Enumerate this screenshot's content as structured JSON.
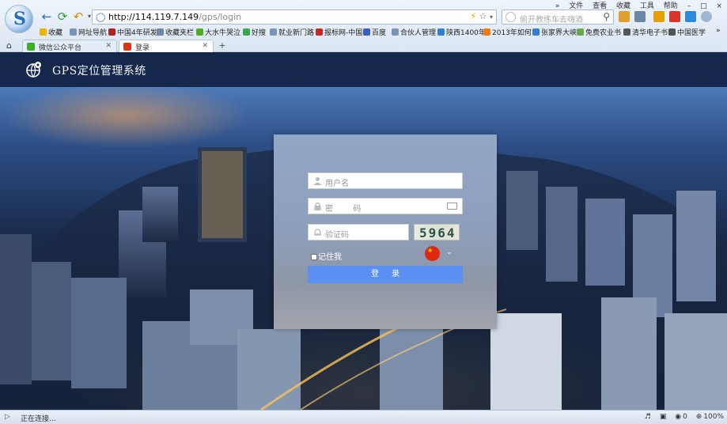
{
  "menubar": [
    "»",
    "文件",
    "查看",
    "收藏",
    "工具",
    "帮助"
  ],
  "address": {
    "url_host": "http://114.119.7.149",
    "url_path": "/gps/login"
  },
  "search": {
    "placeholder": "偷开教练车去嗨酒"
  },
  "bookmarks": [
    {
      "label": "收藏",
      "color": "#f0b400"
    },
    {
      "label": "网址导航",
      "color": "#7a94b8"
    },
    {
      "label": "中国4年研发",
      "color": "#b32020"
    },
    {
      "label": "收藏夹栏",
      "color": "#6f86a8"
    },
    {
      "label": "大水牛哭泣",
      "color": "#4caf20"
    },
    {
      "label": "好搜",
      "color": "#36a64f"
    },
    {
      "label": "就业新门路",
      "color": "#7a94b8"
    },
    {
      "label": "报标网-中国",
      "color": "#c62828"
    },
    {
      "label": "百度",
      "color": "#3d5ccc"
    },
    {
      "label": "合伙人管理",
      "color": "#7a94b8"
    },
    {
      "label": "陕西1400年",
      "color": "#2e7fd6"
    },
    {
      "label": "2013年如何",
      "color": "#f07b10"
    },
    {
      "label": "张家界大峡",
      "color": "#2e7fd6"
    },
    {
      "label": "免费农业书",
      "color": "#6aa84f"
    },
    {
      "label": "清华电子书",
      "color": "#555555"
    },
    {
      "label": "中国医学",
      "color": "#555555"
    },
    {
      "label": "»",
      "color": ""
    }
  ],
  "tabs": [
    {
      "label": "微信公众平台",
      "color": "#3fae29"
    },
    {
      "label": "登录",
      "color": "#d9361c"
    }
  ],
  "header": {
    "title": "GPS定位管理系统"
  },
  "login": {
    "username_placeholder": "用户名",
    "password_placeholder": "密        码",
    "captcha_placeholder": "验证码",
    "captcha_code": "5964",
    "remember_label": "记住我",
    "submit_label": "登录"
  },
  "status": {
    "text": "正在连接...",
    "count": "0",
    "zoom": "100%"
  }
}
